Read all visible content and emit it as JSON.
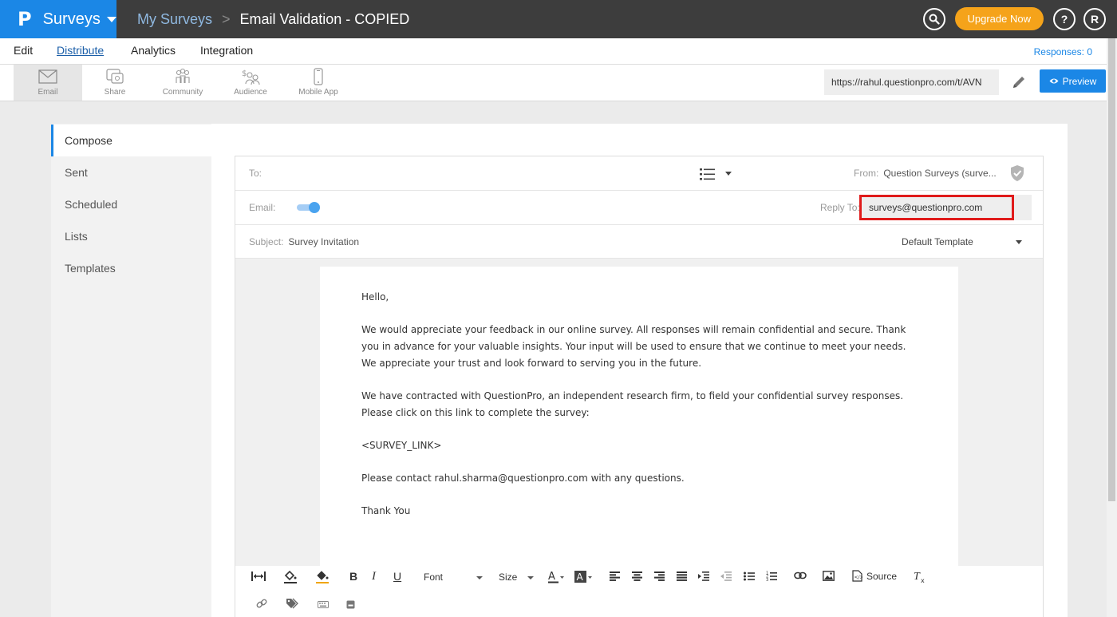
{
  "app": {
    "logo": "P",
    "name": "Surveys"
  },
  "breadcrumb": {
    "parent": "My Surveys",
    "separator": ">",
    "current": "Email Validation - COPIED"
  },
  "topbar": {
    "upgrade_label": "Upgrade Now",
    "help_label": "?",
    "user_initial": "R"
  },
  "nav": {
    "tabs": [
      {
        "label": "Edit"
      },
      {
        "label": "Distribute"
      },
      {
        "label": "Analytics"
      },
      {
        "label": "Integration"
      }
    ],
    "responses": "Responses: 0"
  },
  "tools": {
    "items": [
      {
        "label": "Email",
        "icon": "envelope-icon"
      },
      {
        "label": "Share",
        "icon": "share-icon"
      },
      {
        "label": "Community",
        "icon": "community-icon"
      },
      {
        "label": "Audience",
        "icon": "audience-icon"
      },
      {
        "label": "Mobile App",
        "icon": "mobile-icon"
      }
    ],
    "url": "https://rahul.questionpro.com/t/AVN",
    "preview_label": "Preview"
  },
  "sidebar": {
    "items": [
      {
        "label": "Compose"
      },
      {
        "label": "Sent"
      },
      {
        "label": "Scheduled"
      },
      {
        "label": "Lists"
      },
      {
        "label": "Templates"
      }
    ]
  },
  "compose": {
    "to_label": "To:",
    "from_label": "From:",
    "from_value": "Question Surveys (surve...",
    "email_label": "Email:",
    "reply_label": "Reply To:",
    "reply_value": "surveys@questionpro.com",
    "subject_label": "Subject:",
    "subject_value": "Survey Invitation",
    "template_value": "Default Template"
  },
  "body": {
    "greeting": "Hello,",
    "p1": "We would appreciate your feedback in our online survey. All responses will remain confidential and secure. Thank you in advance for your valuable insights. Your input will be used to ensure that we continue to meet your needs. We appreciate your trust and look forward to serving you in the future.",
    "p2": "We have contracted with QuestionPro, an independent research firm, to field your confidential survey responses. Please click on this link to complete the survey:",
    "link": "<SURVEY_LINK>",
    "contact": "Please contact rahul.sharma@questionpro.com with any questions.",
    "closing": "Thank You"
  },
  "toolbar": {
    "font_label": "Font",
    "size_label": "Size",
    "source_label": "Source"
  },
  "colors": {
    "brand": "#1b87e6",
    "topbar": "#3d3d3d",
    "upgrade": "#f5a31a",
    "highlight": "#e01b1b"
  }
}
